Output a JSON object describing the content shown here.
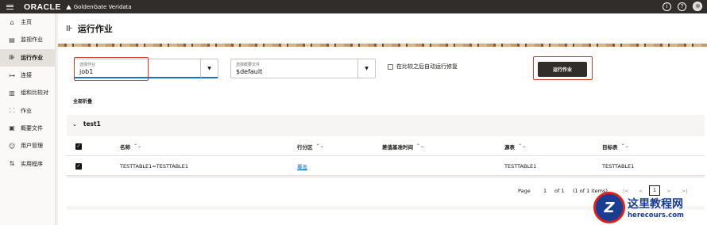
{
  "topbar": {
    "logo": "ORACLE",
    "product": "GoldenGate Veridata",
    "info_icon": "info-icon",
    "help_icon": "help-icon"
  },
  "sidebar": {
    "items": [
      {
        "label": "主页",
        "icon": "home-icon",
        "active": false
      },
      {
        "label": "监视作业",
        "icon": "monitor-icon",
        "active": false
      },
      {
        "label": "运行作业",
        "icon": "run-icon",
        "active": true
      },
      {
        "label": "连接",
        "icon": "connection-icon",
        "active": false
      },
      {
        "label": "组和比较对",
        "icon": "compare-icon",
        "active": false
      },
      {
        "label": "作业",
        "icon": "job-icon",
        "active": false
      },
      {
        "label": "概要文件",
        "icon": "profile-icon",
        "active": false
      },
      {
        "label": "用户管理",
        "icon": "users-icon",
        "active": false
      },
      {
        "label": "实用程序",
        "icon": "utilities-icon",
        "active": false
      }
    ]
  },
  "page": {
    "title": "运行作业",
    "job_field": {
      "label": "选择作业",
      "value": "job1"
    },
    "profile_field": {
      "label": "选择概要文件",
      "value": "$default"
    },
    "auto_repair_label": "在比较之后自动运行修复",
    "run_button": "运行作业",
    "collapse_all": "全部折叠"
  },
  "group": {
    "name": "test1",
    "columns": [
      "名称",
      "行分区",
      "差值基准时间",
      "源表",
      "目标表"
    ],
    "rows": [
      {
        "name": "TESTTABLE1=TESTTABLE1",
        "partition": "覆盖",
        "delta_time": "",
        "source": "TESTTABLE1",
        "target": "TESTTABLE1",
        "checked": true
      }
    ]
  },
  "pager": {
    "page_label": "Page",
    "page_value": "1",
    "of_label": "of 1",
    "items_label": "(1 of 1 items)",
    "current": "1"
  },
  "watermark": {
    "logo_letter": "Z",
    "title": "这里教程网",
    "url": "herecours.com"
  },
  "colors": {
    "topbar": "#312d2a",
    "accent_red": "#d33a2c",
    "link": "#1a6fb6"
  }
}
